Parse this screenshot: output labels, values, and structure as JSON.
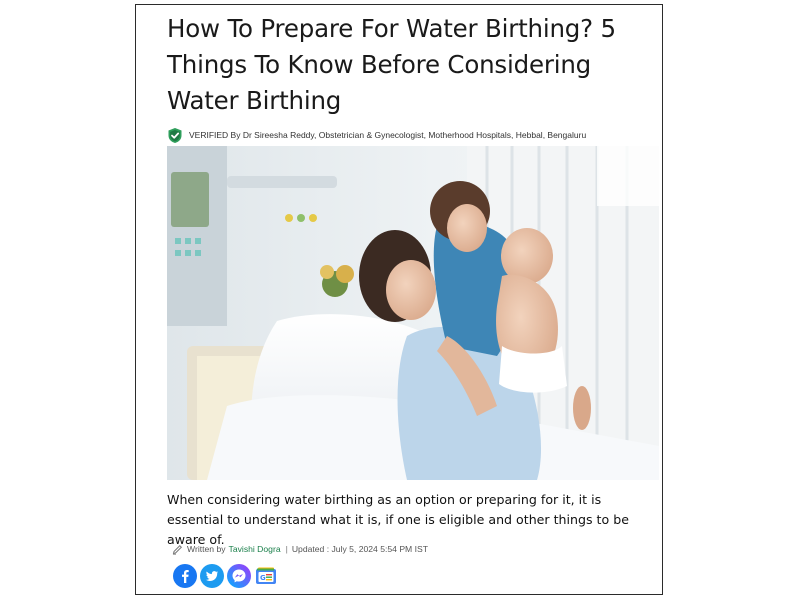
{
  "article": {
    "title": "How To Prepare For Water Birthing? 5 Things To Know Before Considering Water Birthing",
    "verified_text": "VERIFIED By Dr Sireesha Reddy, Obstetrician & Gynecologist, Motherhood Hospitals, Hebbal, Bengaluru",
    "summary": "When considering water birthing as an option or preparing for it, it is essential to understand what it is, if one is eligible and other things to be aware of.",
    "byline": {
      "written_by_label": "Written by",
      "author": "Tavishi Dogra",
      "separator": "|",
      "updated": "Updated : July 5, 2024 5:54 PM IST"
    }
  },
  "icons": {
    "verified": "shield-check-icon",
    "byline": "pencil-icon",
    "share": [
      "facebook-icon",
      "twitter-icon",
      "messenger-icon",
      "google-news-icon"
    ]
  },
  "colors": {
    "verified_shield": "#2e9e5b",
    "author_link": "#1a7f4a",
    "facebook": "#1877f2",
    "twitter": "#1d9bf0",
    "messenger_start": "#00b2ff",
    "messenger_end": "#a334fa"
  }
}
